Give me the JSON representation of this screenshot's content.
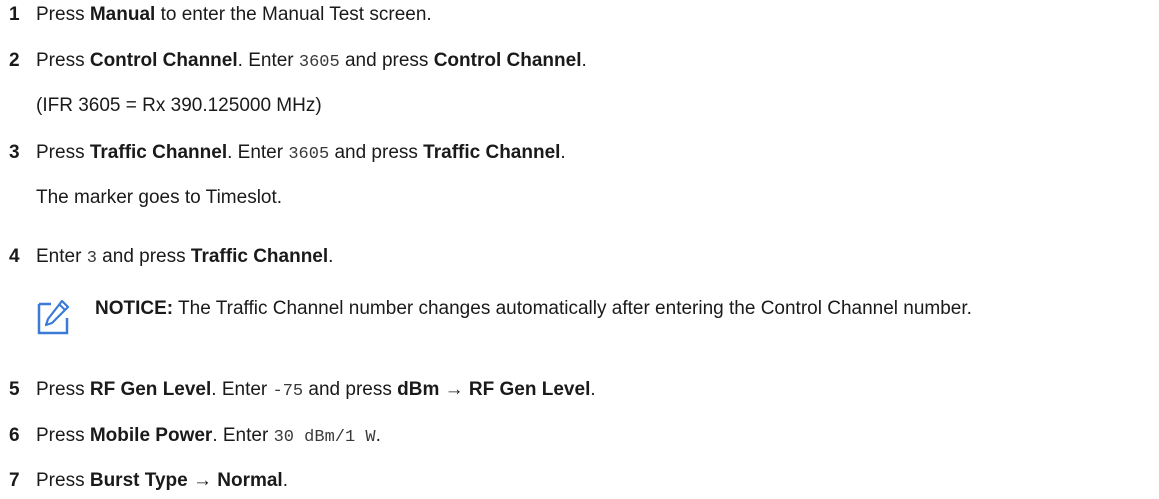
{
  "steps": [
    {
      "num": "1",
      "parts": [
        {
          "t": "Press "
        },
        {
          "t": "Manual",
          "b": true
        },
        {
          "t": " to enter the Manual Test screen."
        }
      ]
    },
    {
      "num": "2",
      "parts": [
        {
          "t": "Press "
        },
        {
          "t": "Control Channel",
          "b": true
        },
        {
          "t": ". Enter "
        },
        {
          "t": "3605",
          "m": true
        },
        {
          "t": " and press "
        },
        {
          "t": "Control Channel",
          "b": true
        },
        {
          "t": "."
        }
      ],
      "note": "(IFR 3605 = Rx 390.125000 MHz)"
    },
    {
      "num": "3",
      "parts": [
        {
          "t": "Press "
        },
        {
          "t": "Traffic Channel",
          "b": true
        },
        {
          "t": ". Enter "
        },
        {
          "t": "3605",
          "m": true
        },
        {
          "t": " and press "
        },
        {
          "t": "Traffic Channel",
          "b": true
        },
        {
          "t": "."
        }
      ],
      "note": "The marker goes to Timeslot."
    },
    {
      "num": "4",
      "parts": [
        {
          "t": "Enter "
        },
        {
          "t": "3",
          "m": true
        },
        {
          "t": " and press "
        },
        {
          "t": "Traffic Channel",
          "b": true
        },
        {
          "t": "."
        }
      ]
    },
    {
      "num": "5",
      "parts": [
        {
          "t": "Press "
        },
        {
          "t": "RF Gen Level",
          "b": true
        },
        {
          "t": ". Enter "
        },
        {
          "t": "-75",
          "m": true
        },
        {
          "t": " and press "
        },
        {
          "t": "dBm → RF Gen Level",
          "b": true
        },
        {
          "t": "."
        }
      ]
    },
    {
      "num": "6",
      "parts": [
        {
          "t": "Press "
        },
        {
          "t": "Mobile Power",
          "b": true
        },
        {
          "t": ". Enter "
        },
        {
          "t": "30 dBm/1 W",
          "m": true
        },
        {
          "t": "."
        }
      ]
    },
    {
      "num": "7",
      "parts": [
        {
          "t": "Press "
        },
        {
          "t": "Burst Type → Normal",
          "b": true
        },
        {
          "t": "."
        }
      ]
    }
  ],
  "notice": {
    "label": "NOTICE:",
    "text": " The Traffic Channel number changes automatically after entering the Control Channel number.",
    "icon": "pencil-note-icon"
  }
}
